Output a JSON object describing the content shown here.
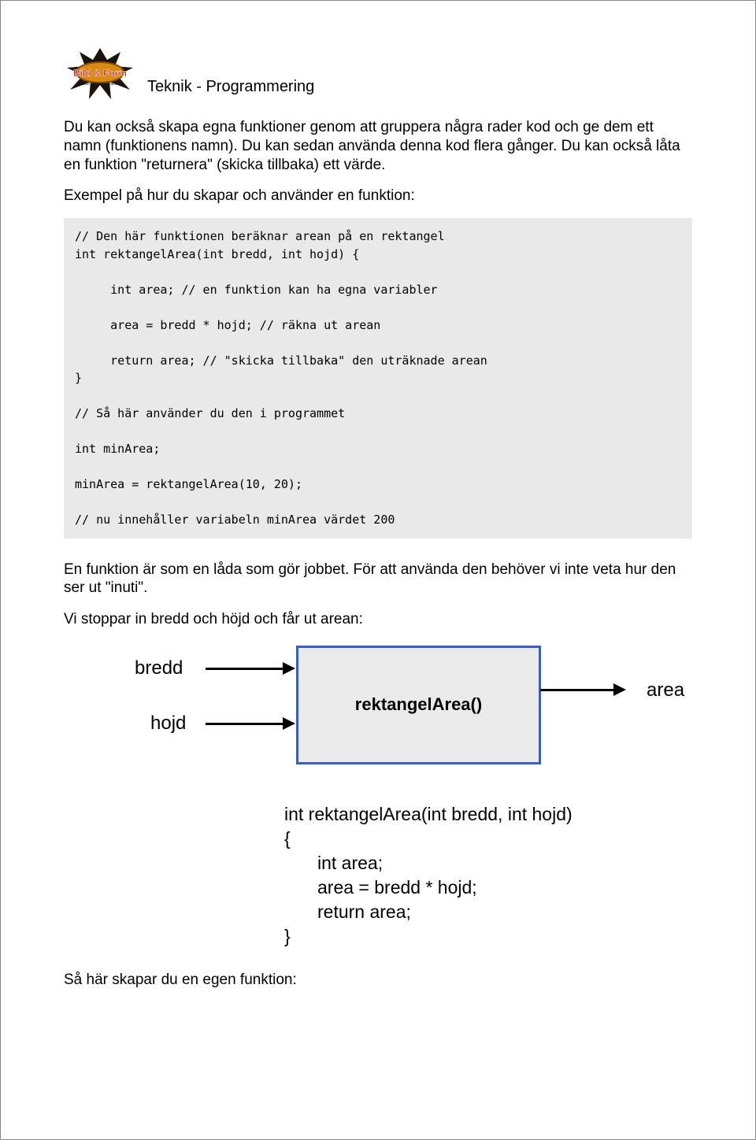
{
  "title": "Teknik - Programmering",
  "intro1": "Du kan också skapa egna funktioner genom att gruppera några rader kod och ge dem ett namn (funktionens namn). Du kan sedan använda denna kod flera gånger. Du kan också låta en funktion \"returnera\" (skicka tillbaka) ett värde.",
  "intro2": "Exempel på hur du skapar och använder en funktion:",
  "code": "// Den här funktionen beräknar arean på en rektangel\nint rektangelArea(int bredd, int hojd) {\n\n     int area; // en funktion kan ha egna variabler\n\n     area = bredd * hojd; // räkna ut arean\n\n     return area; // \"skicka tillbaka\" den uträknade arean\n}\n\n// Så här använder du den i programmet\n\nint minArea;\n\nminArea = rektangelArea(10, 20);\n\n// nu innehåller variabeln minArea värdet 200",
  "after1": "En funktion är som en låda som gör jobbet. För att använda den behöver vi inte veta hur den ser ut \"inuti\".",
  "after2": "Vi stoppar in bredd och höjd och får ut arean:",
  "diagram": {
    "inputs": [
      "bredd",
      "hojd"
    ],
    "boxLabel": "rektangelArea()",
    "output": "area"
  },
  "signature": {
    "line1": "int rektangelArea(int bredd, int hojd)",
    "open": "{",
    "b1": "int area;",
    "b2": "area = bredd * hojd;",
    "b3": "return area;",
    "close": "}"
  },
  "closing": "Så här skapar du en egen funktion:"
}
